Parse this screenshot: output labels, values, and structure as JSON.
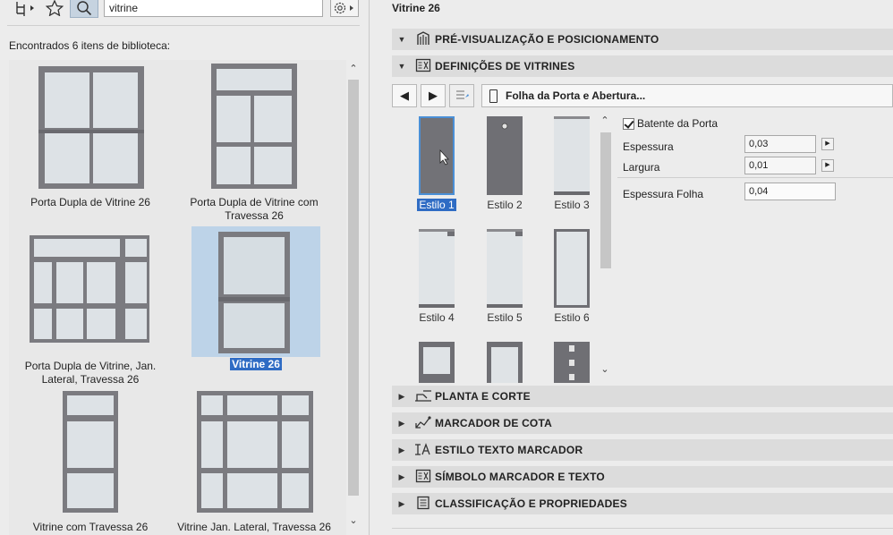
{
  "left_panel": {
    "toolbar": {
      "tree_icon": "hierarchy-icon",
      "favorites_icon": "star-icon",
      "search_icon": "search-icon",
      "settings_icon": "gear-icon"
    },
    "search": {
      "value": "vitrine"
    },
    "found_text": "Encontrados 6 itens de biblioteca:",
    "items": [
      {
        "label_line1": "Porta Dupla de Vitrine 26",
        "label_line2": "",
        "type": "double-door",
        "selected": false
      },
      {
        "label_line1": "Porta Dupla de Vitrine com",
        "label_line2": "Travessa 26",
        "type": "double-door-transom",
        "selected": false
      },
      {
        "label_line1": "Porta Dupla de Vitrine, Jan.",
        "label_line2": "Lateral, Travessa 26",
        "type": "double-door-sidelights",
        "selected": false
      },
      {
        "label_line1": "Vitrine 26",
        "label_line2": "",
        "type": "single-door",
        "selected": true
      },
      {
        "label_line1": "Vitrine com Travessa 26",
        "label_line2": "",
        "type": "single-door-transom",
        "selected": false
      },
      {
        "label_line1": "Vitrine Jan. Lateral, Travessa 26",
        "label_line2": "",
        "type": "single-door-sidelights",
        "selected": false
      }
    ]
  },
  "right_panel": {
    "title": "Vitrine 26",
    "sections": {
      "preview": {
        "title": "PRÉ-VISUALIZAÇÃO E POSICIONAMENTO",
        "icon": "preview-icon"
      },
      "definitions": {
        "title": "DEFINIÇÕES DE VITRINES",
        "icon": "settings-panel-icon"
      },
      "plan": {
        "title": "PLANTA E CORTE",
        "icon": "floor-plan-icon"
      },
      "dimension": {
        "title": "MARCADOR DE COTA",
        "icon": "dimension-marker-icon"
      },
      "text_style": {
        "title": "ESTILO TEXTO MARCADOR",
        "icon": "text-style-icon"
      },
      "symbol": {
        "title": "SÍMBOLO MARCADOR E TEXTO",
        "icon": "symbol-marker-icon"
      },
      "classification": {
        "title": "CLASSIFICAÇÃO E PROPRIEDADES",
        "icon": "classification-icon"
      }
    },
    "page_nav": {
      "current_page": "Folha da Porta e Abertura..."
    },
    "styles": [
      {
        "label": "Estilo 1",
        "selected": true
      },
      {
        "label": "Estilo 2",
        "selected": false
      },
      {
        "label": "Estilo 3",
        "selected": false
      },
      {
        "label": "Estilo 4",
        "selected": false
      },
      {
        "label": "Estilo 5",
        "selected": false
      },
      {
        "label": "Estilo 6",
        "selected": false
      }
    ],
    "properties": {
      "door_stop_label": "Batente da Porta",
      "door_stop_checked": true,
      "thickness_label": "Espessura",
      "thickness_value": "0,03",
      "width_label": "Largura",
      "width_value": "0,01",
      "leaf_thickness_label": "Espessura Folha",
      "leaf_thickness_value": "0,04"
    }
  }
}
